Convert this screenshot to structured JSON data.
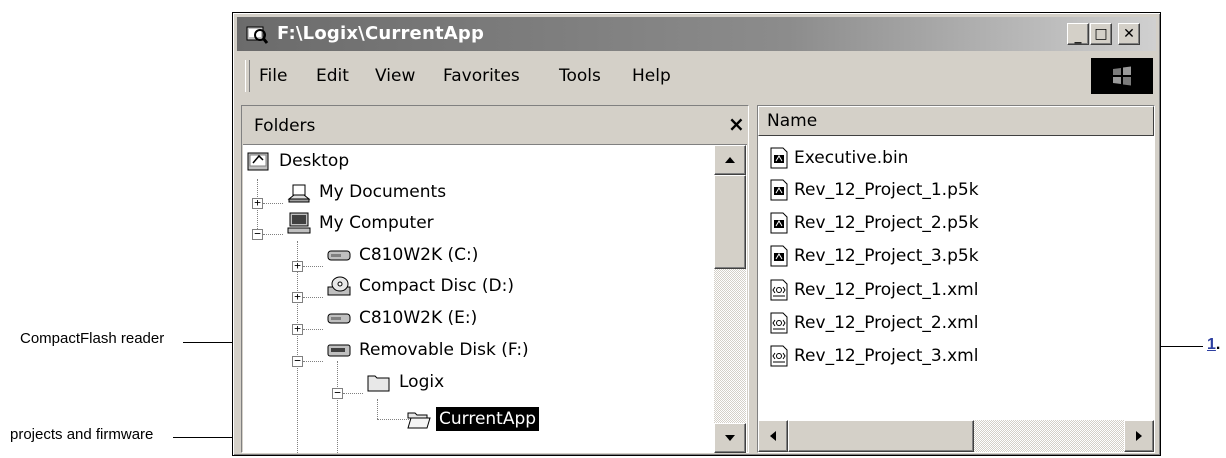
{
  "window": {
    "title": "F:\\Logix\\CurrentApp",
    "controls": {
      "minimize": "_",
      "maximize": "□",
      "close": "✕"
    }
  },
  "menu": [
    "File",
    "Edit",
    "View",
    "Favorites",
    "Tools",
    "Help"
  ],
  "folders": {
    "title": "Folders",
    "close": "×",
    "tree": [
      {
        "label": "Desktop",
        "icon": "desktop-icon",
        "expander": ""
      },
      {
        "label": "My Documents",
        "icon": "my-documents-icon",
        "expander": "+"
      },
      {
        "label": "My Computer",
        "icon": "my-computer-icon",
        "expander": "−"
      },
      {
        "label": "C810W2K (C:)",
        "icon": "hard-drive-icon",
        "expander": "+"
      },
      {
        "label": "Compact Disc (D:)",
        "icon": "cd-drive-icon",
        "expander": "+"
      },
      {
        "label": "C810W2K (E:)",
        "icon": "hard-drive-icon",
        "expander": "+"
      },
      {
        "label": "Removable Disk (F:)",
        "icon": "removable-disk-icon",
        "expander": "−"
      },
      {
        "label": "Logix",
        "icon": "folder-icon",
        "expander": "−"
      },
      {
        "label": "CurrentApp",
        "icon": "open-folder-icon",
        "expander": "",
        "selected": true
      }
    ]
  },
  "files": {
    "column": "Name",
    "items": [
      {
        "label": "Executive.bin",
        "icon": "binary-file-icon"
      },
      {
        "label": "Rev_12_Project_1.p5k",
        "icon": "binary-file-icon"
      },
      {
        "label": "Rev_12_Project_2.p5k",
        "icon": "binary-file-icon"
      },
      {
        "label": "Rev_12_Project_3.p5k",
        "icon": "binary-file-icon"
      },
      {
        "label": "Rev_12_Project_1.xml",
        "icon": "xml-file-icon"
      },
      {
        "label": "Rev_12_Project_2.xml",
        "icon": "xml-file-icon"
      },
      {
        "label": "Rev_12_Project_3.xml",
        "icon": "xml-file-icon"
      }
    ]
  },
  "callouts": {
    "reader": "CompactFlash reader",
    "projects": "projects and firmware",
    "ref": "1",
    "ref_suffix": "."
  }
}
